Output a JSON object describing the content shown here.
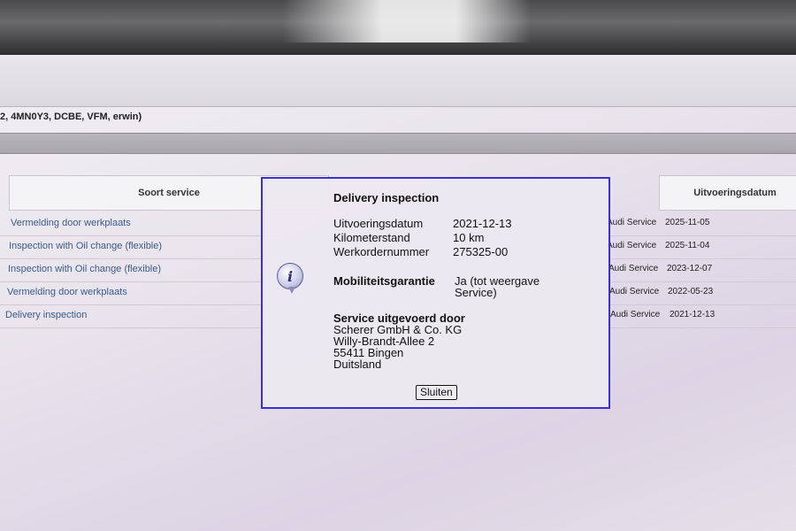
{
  "vehicle": {
    "info_line": "2, 4MN0Y3, DCBE, VFM, erwin)"
  },
  "table": {
    "headers": {
      "service_type": "Soort service",
      "execution_date": "Uitvoeringsdatum"
    },
    "rows": [
      {
        "service": "Vermelding door werkplaats",
        "organization": "Audi Service",
        "date": "2025-11-05"
      },
      {
        "service": "Inspection with Oil change (flexible)",
        "organization": "Audi Service",
        "date": "2025-11-04"
      },
      {
        "service": "Inspection with Oil change (flexible)",
        "organization": "Audi Service",
        "date": "2023-12-07"
      },
      {
        "service": "Vermelding door werkplaats",
        "organization": "Audi Service",
        "date": "2022-05-23"
      },
      {
        "service": "Delivery inspection",
        "organization": "Audi Service",
        "date": "2021-12-13"
      }
    ]
  },
  "dialog": {
    "title": "Delivery inspection",
    "fields": [
      {
        "label": "Uitvoeringsdatum",
        "value": "2021-12-13"
      },
      {
        "label": "Kilometerstand",
        "value": "10 km"
      },
      {
        "label": "Werkordernummer",
        "value": "275325-00"
      }
    ],
    "mobility_label": "Mobiliteitsgarantie",
    "mobility_value_line1": "Ja (tot weergave",
    "mobility_value_line2": "Service)",
    "service_by_label": "Service uitgevoerd door",
    "address": [
      "Scherer GmbH & Co. KG",
      "Willy-Brandt-Allee 2",
      "55411 Bingen",
      "Duitsland"
    ],
    "close_label": "Sluiten",
    "icon": "info-icon"
  },
  "colors": {
    "dialog_border": "#3b2fd1",
    "link_text": "#3a5a8c"
  }
}
